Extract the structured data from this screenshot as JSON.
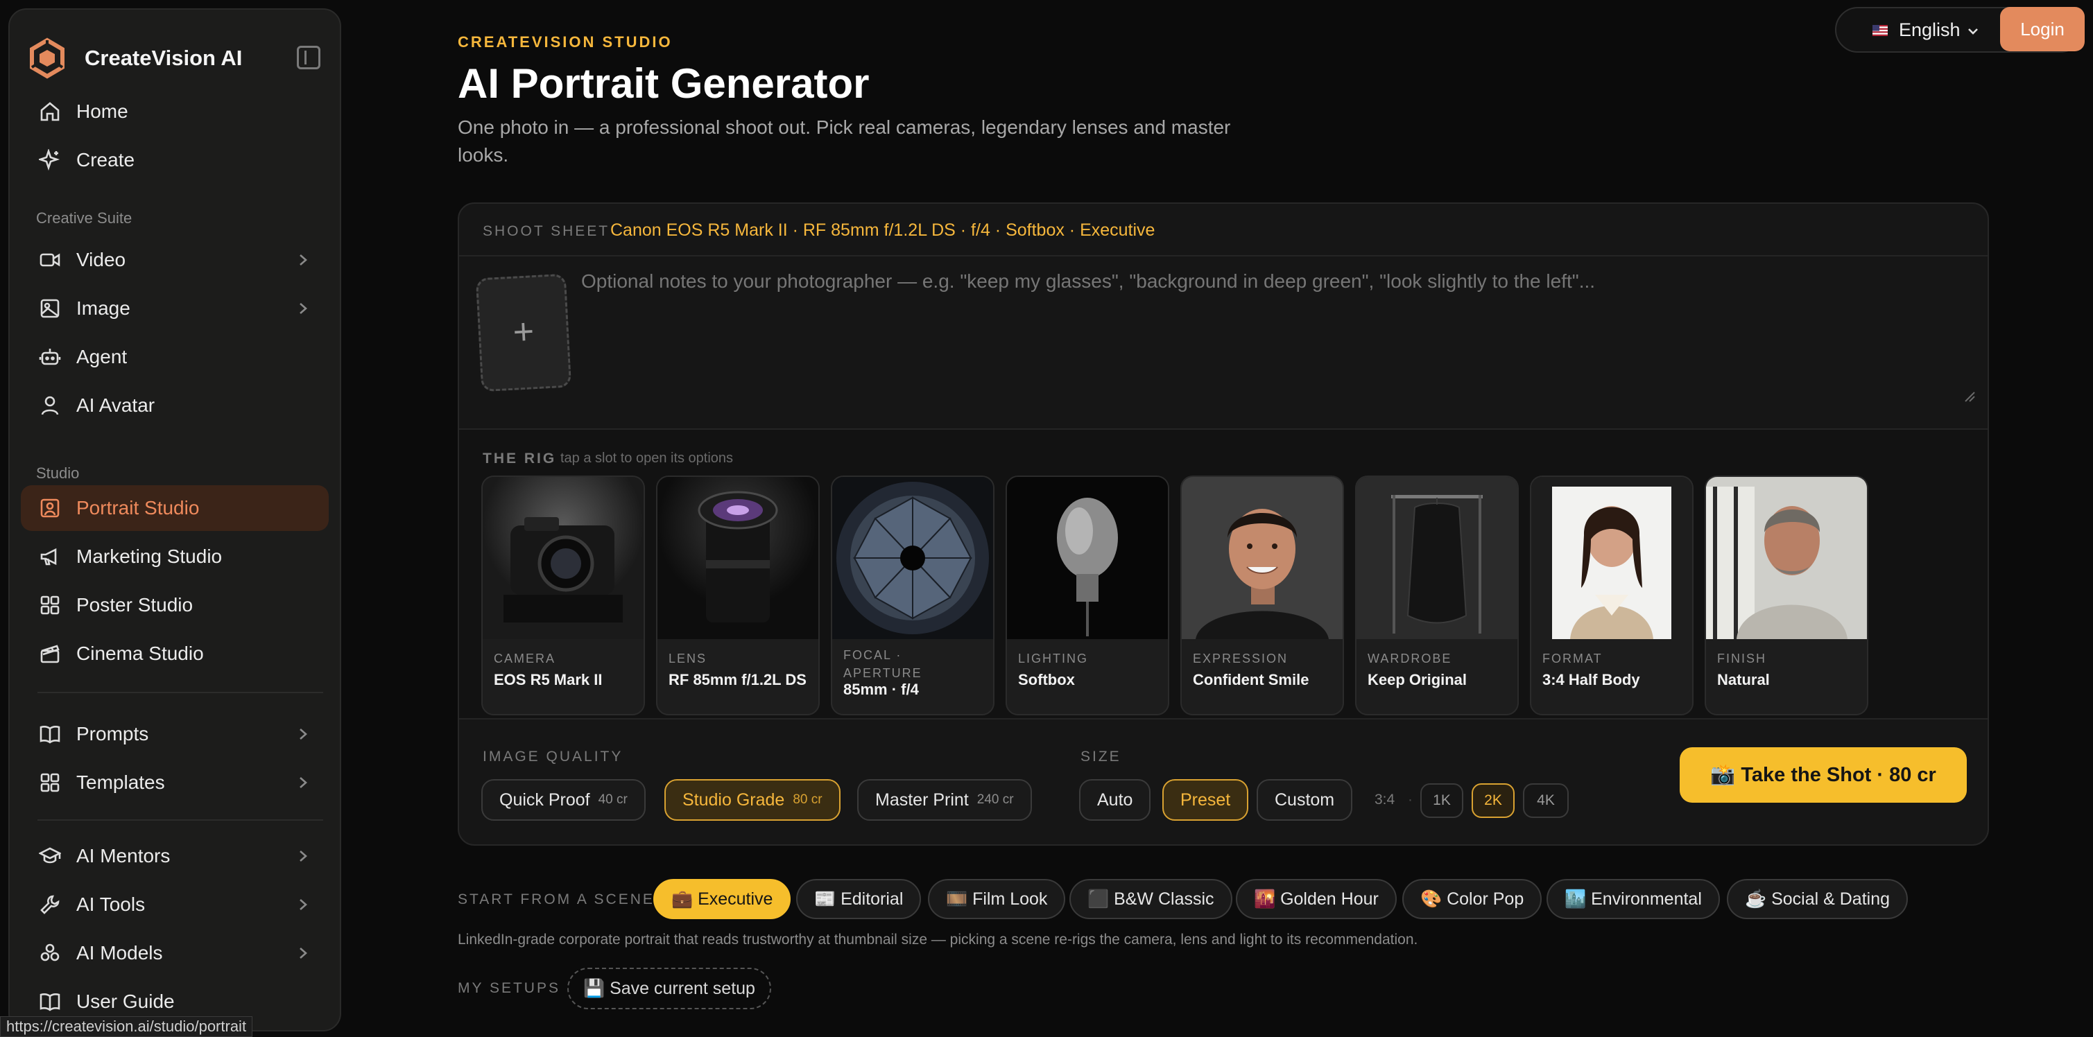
{
  "app": {
    "name": "CreateVision AI"
  },
  "sidebar": {
    "top_items": [
      {
        "label": "Home",
        "icon": "home-icon"
      },
      {
        "label": "Create",
        "icon": "sparkle-icon"
      }
    ],
    "creative_suite_label": "Creative Suite",
    "creative_items": [
      {
        "label": "Video",
        "icon": "video-icon"
      },
      {
        "label": "Image",
        "icon": "image-icon"
      },
      {
        "label": "Agent",
        "icon": "robot-icon"
      },
      {
        "label": "AI Avatar",
        "icon": "user-icon"
      }
    ],
    "studio_label": "Studio",
    "studio_items": [
      {
        "label": "Portrait Studio",
        "icon": "portrait-icon",
        "active": true
      },
      {
        "label": "Marketing Studio",
        "icon": "megaphone-icon"
      },
      {
        "label": "Poster Studio",
        "icon": "grid-icon"
      },
      {
        "label": "Cinema Studio",
        "icon": "clapperboard-icon"
      }
    ],
    "library_items": [
      {
        "label": "Prompts",
        "icon": "book-icon"
      },
      {
        "label": "Templates",
        "icon": "grid-icon"
      }
    ],
    "tool_items": [
      {
        "label": "AI Mentors",
        "icon": "graduation-cap-icon"
      },
      {
        "label": "AI Tools",
        "icon": "wrench-icon"
      },
      {
        "label": "AI Models",
        "icon": "models-icon"
      },
      {
        "label": "User Guide",
        "icon": "book-icon"
      }
    ]
  },
  "status_url": "https://createvision.ai/studio/portrait",
  "header": {
    "eyebrow": "CREATEVISION STUDIO",
    "title": "AI Portrait Generator",
    "subtitle": "One photo in — a professional shoot out. Pick real cameras, legendary lenses and master looks.",
    "language": "English",
    "language_flag": "us-flag",
    "login": "Login"
  },
  "shoot_sheet": {
    "label": "SHOOT SHEET",
    "value": "Canon EOS R5 Mark II · RF 85mm f/1.2L DS · f/4 · Softbox · Executive",
    "upload_symbol": "+",
    "notes_placeholder": "Optional notes to your photographer — e.g. \"keep my glasses\", \"background in deep green\", \"look slightly to the left\"..."
  },
  "rig": {
    "title": "THE RIG",
    "hint": "tap a slot to open its options",
    "slots": [
      {
        "caption": "CAMERA",
        "value": "EOS R5 Mark II",
        "thumb": "camera-thumbnail"
      },
      {
        "caption": "LENS",
        "value": "RF 85mm f/1.2L DS",
        "thumb": "lens-thumbnail"
      },
      {
        "caption": "FOCAL · APERTURE",
        "value": "85mm · f/4",
        "thumb": "aperture-thumbnail"
      },
      {
        "caption": "LIGHTING",
        "value": "Softbox",
        "thumb": "mannequin-head-thumbnail"
      },
      {
        "caption": "EXPRESSION",
        "value": "Confident Smile",
        "thumb": "smiling-man-thumbnail"
      },
      {
        "caption": "WARDROBE",
        "value": "Keep Original",
        "thumb": "garment-bag-thumbnail"
      },
      {
        "caption": "FORMAT",
        "value": "3:4 Half Body",
        "thumb": "woman-portrait-thumbnail"
      },
      {
        "caption": "FINISH",
        "value": "Natural",
        "thumb": "older-man-thumbnail"
      }
    ]
  },
  "quality": {
    "label": "IMAGE QUALITY",
    "options": [
      {
        "name": "Quick Proof",
        "cost": "40 cr",
        "selected": false
      },
      {
        "name": "Studio Grade",
        "cost": "80 cr",
        "selected": true
      },
      {
        "name": "Master Print",
        "cost": "240 cr",
        "selected": false
      }
    ]
  },
  "size": {
    "label": "SIZE",
    "modes": [
      {
        "name": "Auto",
        "selected": false
      },
      {
        "name": "Preset",
        "selected": true
      },
      {
        "name": "Custom",
        "selected": false
      }
    ],
    "ratio": "3:4",
    "separator": "·",
    "resolutions": [
      {
        "name": "1K",
        "selected": false
      },
      {
        "name": "2K",
        "selected": true
      },
      {
        "name": "4K",
        "selected": false
      }
    ]
  },
  "take_shot": "📸 Take the Shot · 80 cr",
  "scenes": {
    "label": "START FROM A SCENE",
    "items": [
      {
        "label": "💼 Executive",
        "selected": true
      },
      {
        "label": "📰 Editorial",
        "selected": false
      },
      {
        "label": "🎞️ Film Look",
        "selected": false
      },
      {
        "label": "⬛ B&W Classic",
        "selected": false
      },
      {
        "label": "🌇 Golden Hour",
        "selected": false
      },
      {
        "label": "🎨 Color Pop",
        "selected": false
      },
      {
        "label": "🏙️ Environmental",
        "selected": false
      },
      {
        "label": "☕ Social & Dating",
        "selected": false
      }
    ],
    "description": "LinkedIn-grade corporate portrait that reads trustworthy at thumbnail size — picking a scene re-rigs the camera, lens and light to its recommendation."
  },
  "setups": {
    "label": "MY SETUPS",
    "save": "💾 Save current setup"
  },
  "colors": {
    "accent": "#f6be2c",
    "brand": "#e38a5d",
    "active_nav_bg": "#3b2418",
    "background": "#0b0b0b"
  }
}
